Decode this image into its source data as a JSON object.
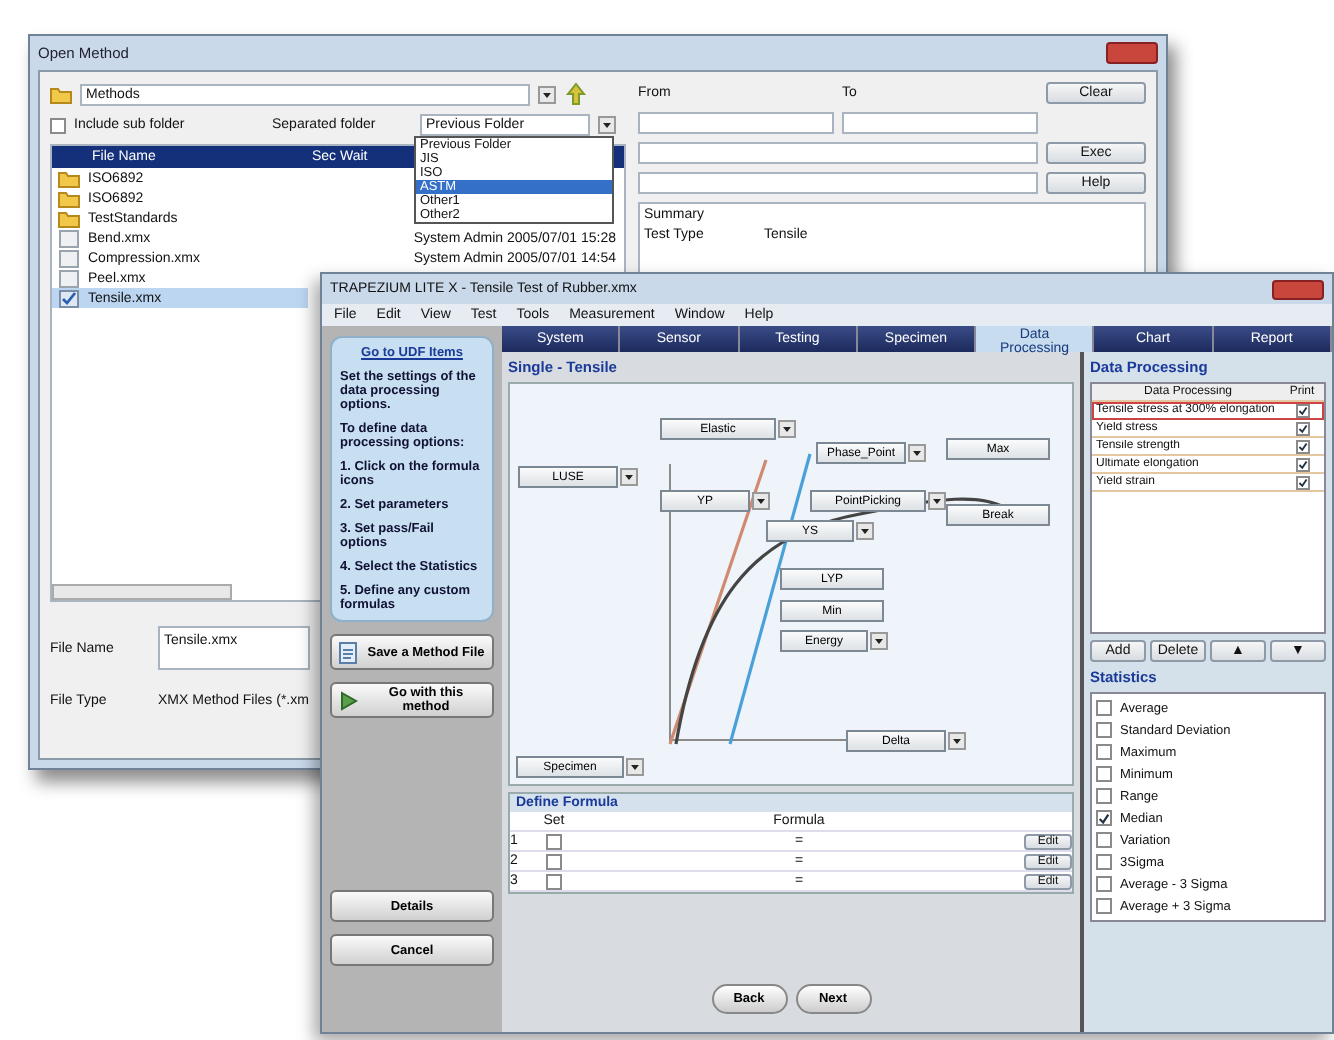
{
  "open_method": {
    "title": "Open Method",
    "folder": "Methods",
    "include_sub_folder": {
      "label": "Include sub folder",
      "checked": false
    },
    "separated_label": "Separated folder",
    "separated_value": "Previous Folder",
    "separated_options": [
      {
        "label": "Previous Folder",
        "selected": false
      },
      {
        "label": "JIS",
        "selected": false
      },
      {
        "label": "ISO",
        "selected": false
      },
      {
        "label": "ASTM",
        "selected": true
      },
      {
        "label": "Other1",
        "selected": false
      },
      {
        "label": "Other2",
        "selected": false
      }
    ],
    "columns": [
      "File Name",
      "Sec Wait"
    ],
    "files": [
      {
        "kind": "folder",
        "name": "ISO6892",
        "selected": false
      },
      {
        "kind": "folder",
        "name": "ISO6892",
        "selected": false
      },
      {
        "kind": "folder",
        "name": "TestStandards",
        "selected": false
      },
      {
        "kind": "file",
        "name": "Bend.xmx",
        "detail": "System Admin 2005/07/01 15:28",
        "selected": false
      },
      {
        "kind": "file",
        "name": "Compression.xmx",
        "detail": "System Admin 2005/07/01 14:54",
        "selected": false
      },
      {
        "kind": "file",
        "name": "Peel.xmx",
        "selected": false
      },
      {
        "kind": "file",
        "name": "Tensile.xmx",
        "selected": true
      }
    ],
    "file_name_label": "File Name",
    "file_name": "Tensile.xmx",
    "file_type_label": "File Type",
    "file_type": "XMX Method Files (*.xm",
    "from_label": "From",
    "to_label": "To",
    "buttons": [
      "Clear",
      "Exec",
      "Help"
    ],
    "summary_title": "Summary",
    "summary": [
      {
        "key": "Test Type",
        "value": "Tensile"
      }
    ]
  },
  "editor": {
    "title": "TRAPEZIUM LITE X - Tensile Test of Rubber.xmx",
    "menu": [
      "File",
      "Edit",
      "View",
      "Test",
      "Tools",
      "Measurement",
      "Window",
      "Help"
    ],
    "tabs": [
      {
        "label": "System",
        "selected": false
      },
      {
        "label": "Sensor",
        "selected": false
      },
      {
        "label": "Testing",
        "selected": false
      },
      {
        "label": "Specimen",
        "selected": false
      },
      {
        "label": "Data Processing",
        "selected": true
      },
      {
        "label": "Chart",
        "selected": false
      },
      {
        "label": "Report",
        "selected": false
      }
    ],
    "guide_link": "Go to UDF Items",
    "guide_intro": "Set the settings of the data processing options.",
    "guide_heading": "To define data processing options:",
    "guide_steps": [
      "1. Click on the formula icons",
      "2. Set parameters",
      "3. Set pass/Fail options",
      "4. Select the Statistics",
      "5. Define any custom formulas"
    ],
    "side_buttons": [
      "Save a Method File",
      "Go with this method"
    ],
    "bottom_side_buttons": [
      "Details",
      "Cancel"
    ],
    "panel_title": "Single - Tensile",
    "nodes": [
      {
        "label": "Elastic",
        "dropdown": true
      },
      {
        "label": "LUSE",
        "dropdown": true
      },
      {
        "label": "YP",
        "dropdown": true
      },
      {
        "label": "Phase_Point",
        "dropdown": true
      },
      {
        "label": "Max",
        "dropdown": false
      },
      {
        "label": "PointPicking",
        "dropdown": true
      },
      {
        "label": "Break",
        "dropdown": false
      },
      {
        "label": "YS",
        "dropdown": true
      },
      {
        "label": "LYP",
        "dropdown": false
      },
      {
        "label": "Min",
        "dropdown": false
      },
      {
        "label": "Energy",
        "dropdown": true
      },
      {
        "label": "Delta",
        "dropdown": true
      },
      {
        "label": "Specimen",
        "dropdown": true
      }
    ],
    "formula_title": "Define Formula",
    "formula_columns": [
      "Set",
      "Formula"
    ],
    "formulas": [
      {
        "index": "1",
        "set": false,
        "eq": "=",
        "edit": "Edit"
      },
      {
        "index": "2",
        "set": false,
        "eq": "=",
        "edit": "Edit"
      },
      {
        "index": "3",
        "set": false,
        "eq": "=",
        "edit": "Edit"
      }
    ],
    "data_processing_title": "Data Processing",
    "dp_columns": [
      "Data Processing",
      "Print"
    ],
    "dp_items": [
      {
        "name": "Tensile stress at 300% elongation",
        "print": true,
        "selected": true
      },
      {
        "name": "Yield stress",
        "print": true,
        "selected": false
      },
      {
        "name": "Tensile strength",
        "print": true,
        "selected": false
      },
      {
        "name": "Ultimate elongation",
        "print": true,
        "selected": false
      },
      {
        "name": "Yield strain",
        "print": true,
        "selected": false
      }
    ],
    "dp_buttons": [
      "Add",
      "Delete",
      "▲",
      "▼"
    ],
    "statistics_title": "Statistics",
    "statistics": [
      {
        "label": "Average",
        "checked": false
      },
      {
        "label": "Standard Deviation",
        "checked": false
      },
      {
        "label": "Maximum",
        "checked": false
      },
      {
        "label": "Minimum",
        "checked": false
      },
      {
        "label": "Range",
        "checked": false
      },
      {
        "label": "Median",
        "checked": true
      },
      {
        "label": "Variation",
        "checked": false
      },
      {
        "label": "3Sigma",
        "checked": false
      },
      {
        "label": "Average - 3 Sigma",
        "checked": false
      },
      {
        "label": "Average + 3 Sigma",
        "checked": false
      }
    ],
    "nav_buttons": [
      "Back",
      "Next"
    ]
  }
}
